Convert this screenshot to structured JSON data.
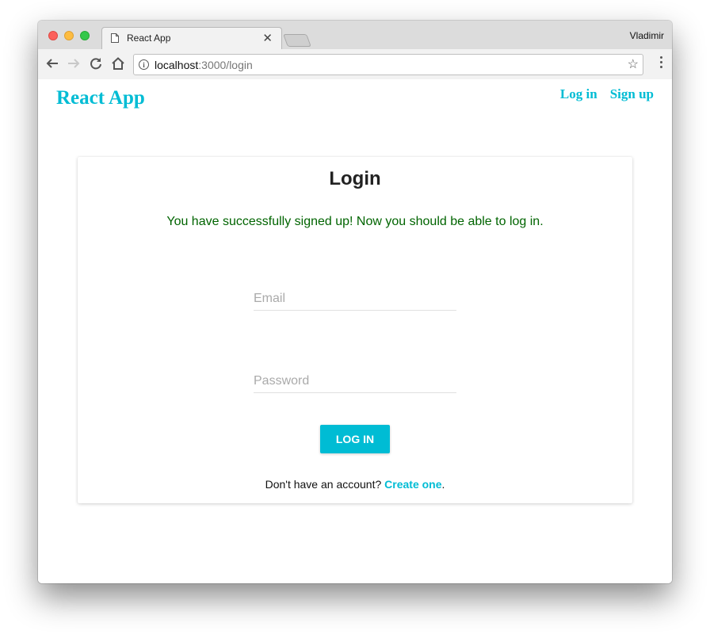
{
  "browser": {
    "tab_title": "React App",
    "profile_name": "Vladimir",
    "url_host": "localhost",
    "url_rest": ":3000/login",
    "icons": {
      "back": "arrow-left-icon",
      "forward": "arrow-right-icon",
      "reload": "reload-icon",
      "home": "home-icon",
      "info": "info-icon",
      "bookmark": "star-icon",
      "menu": "menu-dots-icon",
      "close_tab": "close-icon"
    }
  },
  "header": {
    "brand": "React App",
    "nav": [
      {
        "label": "Log in"
      },
      {
        "label": "Sign up"
      }
    ]
  },
  "login": {
    "title": "Login",
    "success_message": "You have successfully signed up! Now you should be able to log in.",
    "email_placeholder": "Email",
    "email_value": "",
    "password_placeholder": "Password",
    "password_value": "",
    "submit_label": "LOG IN",
    "signup_prompt": "Don't have an account?",
    "signup_link": "Create one",
    "signup_suffix": "."
  },
  "colors": {
    "accent": "#00bcd4",
    "success": "#006400"
  }
}
